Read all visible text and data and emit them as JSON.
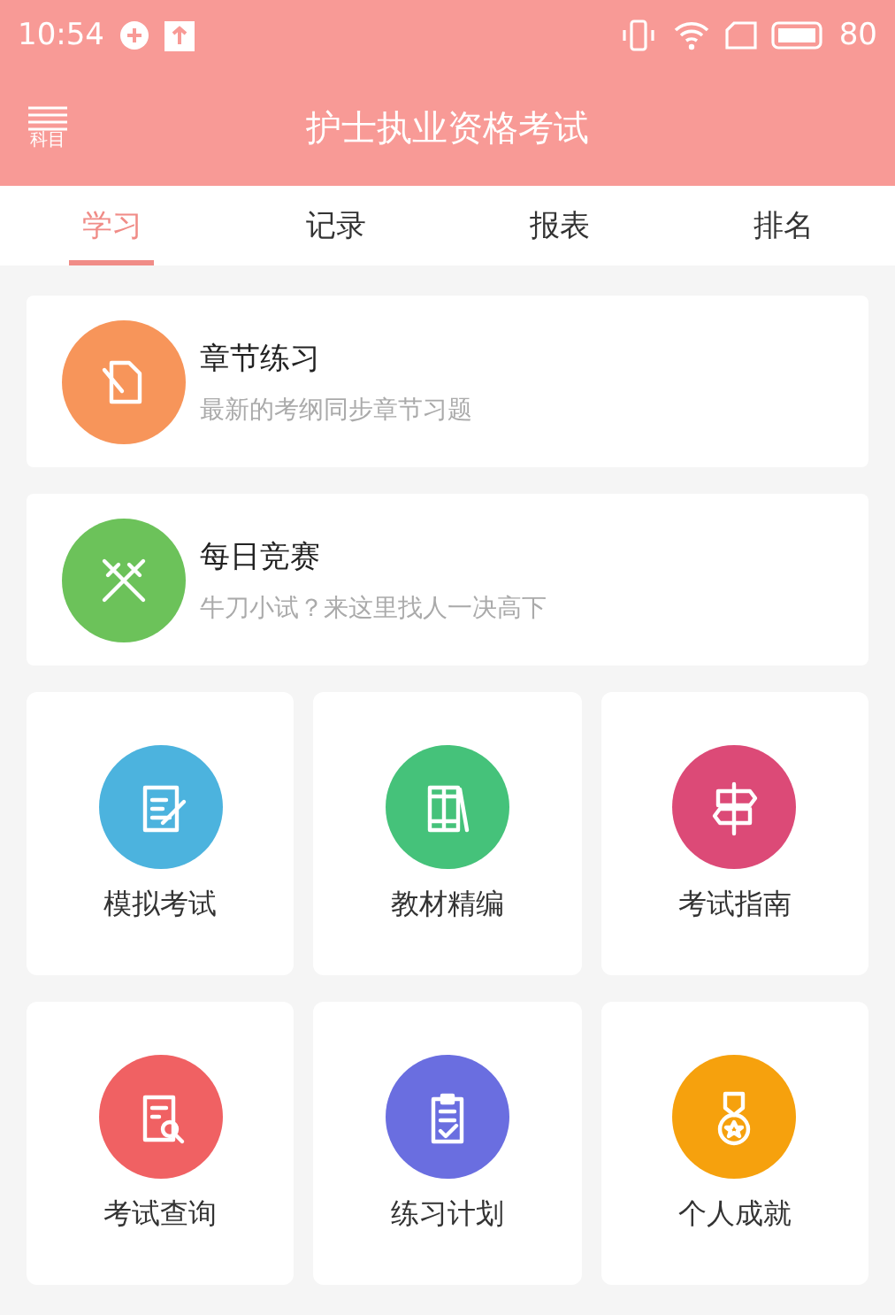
{
  "status_bar": {
    "time": "10:54",
    "battery": "80"
  },
  "header": {
    "menu_label": "科目",
    "title": "护士执业资格考试"
  },
  "tabs": [
    {
      "label": "学习",
      "selected": true
    },
    {
      "label": "记录",
      "selected": false
    },
    {
      "label": "报表",
      "selected": false
    },
    {
      "label": "排名",
      "selected": false
    }
  ],
  "features": [
    {
      "title": "章节练习",
      "subtitle": "最新的考纲同步章节习题",
      "color": "#f7955a"
    },
    {
      "title": "每日竞赛",
      "subtitle": "牛刀小试？来这里找人一决高下",
      "color": "#6cc25a"
    }
  ],
  "tiles": [
    {
      "label": "模拟考试",
      "color": "#4cb3de"
    },
    {
      "label": "教材精编",
      "color": "#45c27a"
    },
    {
      "label": "考试指南",
      "color": "#dc4a77"
    },
    {
      "label": "考试查询",
      "color": "#f06163"
    },
    {
      "label": "练习计划",
      "color": "#6a6ee0"
    },
    {
      "label": "个人成就",
      "color": "#f6a10d"
    }
  ]
}
